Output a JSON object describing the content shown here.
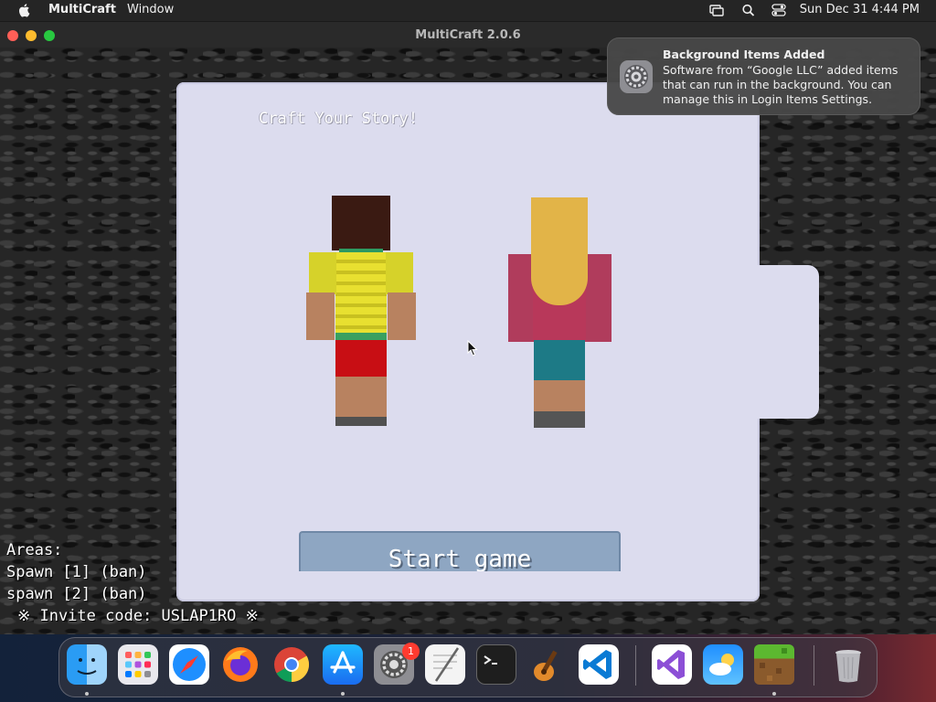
{
  "menubar": {
    "app_name": "MultiCraft",
    "menu_window": "Window",
    "clock": "Sun Dec 31  4:44 PM",
    "icons": [
      "apple-icon",
      "screen-mirror-icon",
      "search-icon",
      "control-center-icon"
    ]
  },
  "window": {
    "title": "MultiCraft 2.0.6"
  },
  "game": {
    "panel_title": "Craft Your Story!",
    "start_button": "Start game",
    "areas_heading": "Areas:",
    "areas": [
      "Spawn [1] (ban)",
      "spawn [2] (ban)"
    ],
    "invite": "※ Invite code: USLAP1RO ※"
  },
  "notification": {
    "title": "Background Items Added",
    "body": "Software from “Google LLC” added items that can run in the background. You can manage this in Login Items Settings.",
    "icon": "system-settings-icon"
  },
  "dock": {
    "apps": [
      "finder",
      "launchpad",
      "safari",
      "firefox",
      "chrome",
      "app-store",
      "system-settings",
      "textedit",
      "terminal",
      "garageband",
      "vscode",
      "visual-studio",
      "weather",
      "multicraft",
      "trash"
    ],
    "system_settings_badge": "1"
  },
  "colors": {
    "panel": "#dcdcee",
    "button": "#8ea6c2",
    "notification": "#484848",
    "close": "#fe5f57",
    "minimize": "#febc2e",
    "maximize": "#28c840"
  }
}
